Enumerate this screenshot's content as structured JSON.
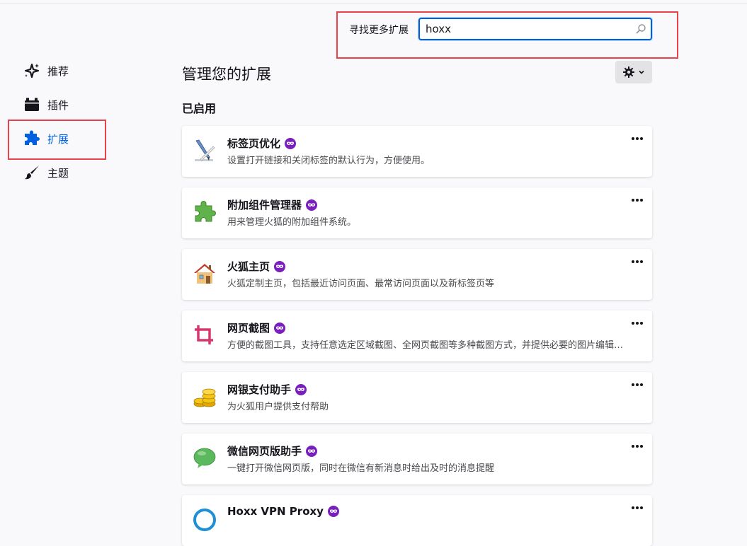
{
  "search": {
    "label": "寻找更多扩展",
    "value": "hoxx"
  },
  "sidebar": {
    "items": [
      {
        "label": "推荐",
        "icon": "sparkle-icon"
      },
      {
        "label": "插件",
        "icon": "plugin-icon"
      },
      {
        "label": "扩展",
        "icon": "puzzle-icon",
        "active": true
      },
      {
        "label": "主题",
        "icon": "brush-icon"
      }
    ]
  },
  "main": {
    "title": "管理您的扩展",
    "section": "已启用",
    "addons": [
      {
        "name": "标签页优化",
        "desc": "设置打开链接和关闭标签的默认行为，方便使用。",
        "icon": "pen-ruler-icon"
      },
      {
        "name": "附加组件管理器",
        "desc": "用来管理火狐的附加组件系统。",
        "icon": "green-puzzle-icon"
      },
      {
        "name": "火狐主页",
        "desc": "火狐定制主页，包括最近访问页面、最常访问页面以及新标签页等",
        "icon": "house-icon"
      },
      {
        "name": "网页截图",
        "desc": "方便的截图工具，支持任意选定区域截图、全网页截图等多种截图方式，并提供必要的图片编辑功能",
        "icon": "crop-icon"
      },
      {
        "name": "网银支付助手",
        "desc": "为火狐用户提供支付帮助",
        "icon": "coins-icon"
      },
      {
        "name": "微信网页版助手",
        "desc": "一键打开微信网页版，同时在微信有新消息时给出及时的消息提醒",
        "icon": "wechat-icon"
      },
      {
        "name": "Hoxx VPN Proxy",
        "desc": "",
        "icon": "hoxx-icon"
      }
    ]
  },
  "colors": {
    "accent": "#0061e0",
    "highlight": "#e8424b",
    "badge": "#7a1fbf"
  }
}
